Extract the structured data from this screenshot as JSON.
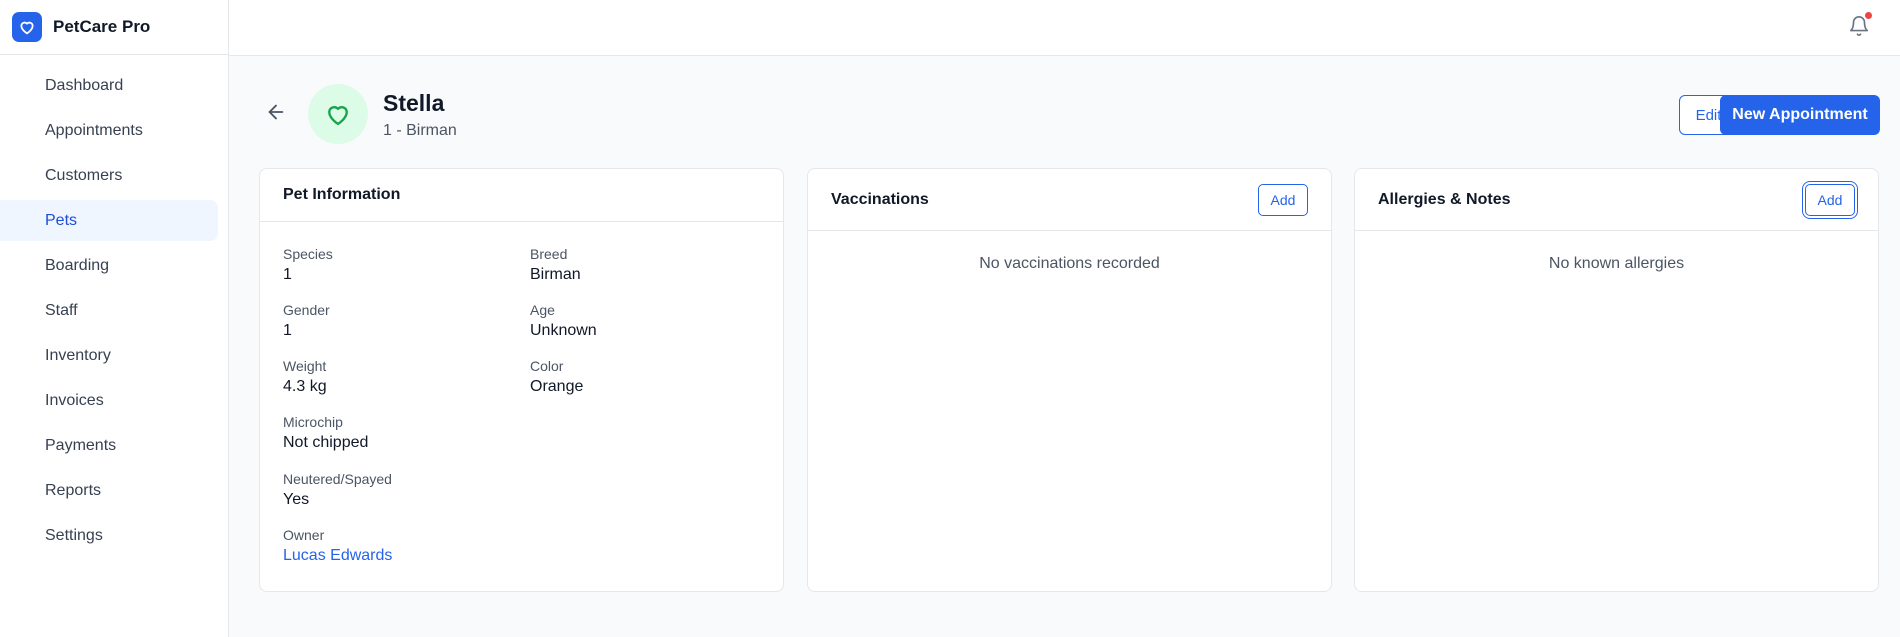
{
  "app": {
    "name": "PetCare Pro"
  },
  "nav": {
    "items": [
      {
        "label": "Dashboard"
      },
      {
        "label": "Appointments"
      },
      {
        "label": "Customers"
      },
      {
        "label": "Pets"
      },
      {
        "label": "Boarding"
      },
      {
        "label": "Staff"
      },
      {
        "label": "Inventory"
      },
      {
        "label": "Invoices"
      },
      {
        "label": "Payments"
      },
      {
        "label": "Reports"
      },
      {
        "label": "Settings"
      }
    ],
    "active": "Pets"
  },
  "header": {
    "pet_name": "Stella",
    "subtitle": "1 - Birman",
    "edit_label": "Edit",
    "new_appointment_label": "New Appointment"
  },
  "pet_info": {
    "title": "Pet Information",
    "species_label": "Species",
    "species": "1",
    "breed_label": "Breed",
    "breed": "Birman",
    "gender_label": "Gender",
    "gender": "1",
    "age_label": "Age",
    "age": "Unknown",
    "weight_label": "Weight",
    "weight": "4.3 kg",
    "color_label": "Color",
    "color": "Orange",
    "microchip_label": "Microchip",
    "microchip": "Not chipped",
    "neutered_label": "Neutered/Spayed",
    "neutered": "Yes",
    "owner_label": "Owner",
    "owner": "Lucas Edwards"
  },
  "vaccinations": {
    "title": "Vaccinations",
    "add_label": "Add",
    "empty": "No vaccinations recorded"
  },
  "allergies": {
    "title": "Allergies & Notes",
    "add_label": "Add",
    "empty": "No known allergies"
  },
  "colors": {
    "accent": "#2563eb",
    "active_nav_bg": "#eff6ff",
    "avatar_bg": "#dcfce7",
    "avatar_icon": "#16a34a",
    "notification_dot": "#ef4444"
  },
  "icons": {
    "brand": "heart-icon",
    "notifications": "bell-icon",
    "back": "arrow-left-icon",
    "pet_avatar": "heart-icon"
  }
}
